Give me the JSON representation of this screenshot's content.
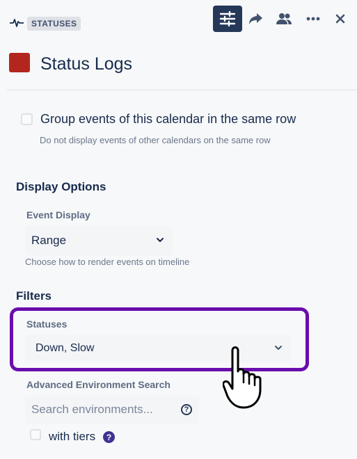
{
  "header": {
    "badge": "STATUSES",
    "title": "Status Logs",
    "calendar_color": "#b3261e",
    "toolbar": [
      {
        "name": "settings-icon",
        "active": true
      },
      {
        "name": "share-icon"
      },
      {
        "name": "people-icon"
      },
      {
        "name": "more-icon"
      },
      {
        "name": "close-icon"
      }
    ]
  },
  "group_events": {
    "label": "Group events of this calendar in the same row",
    "help": "Do not display events of other calendars on the same row",
    "checked": false
  },
  "display_options": {
    "heading": "Display Options",
    "event_display": {
      "label": "Event Display",
      "value": "Range",
      "help": "Choose how to render events on timeline"
    }
  },
  "filters": {
    "heading": "Filters",
    "statuses": {
      "label": "Statuses",
      "value": "Down, Slow"
    },
    "advanced_search": {
      "label": "Advanced Environment Search",
      "placeholder": "Search environments..."
    },
    "with_tiers": {
      "label": "with tiers",
      "checked": false
    }
  },
  "colors": {
    "accent_dark": "#253858",
    "highlight": "#6a0dad",
    "help_icon": "#403294"
  }
}
